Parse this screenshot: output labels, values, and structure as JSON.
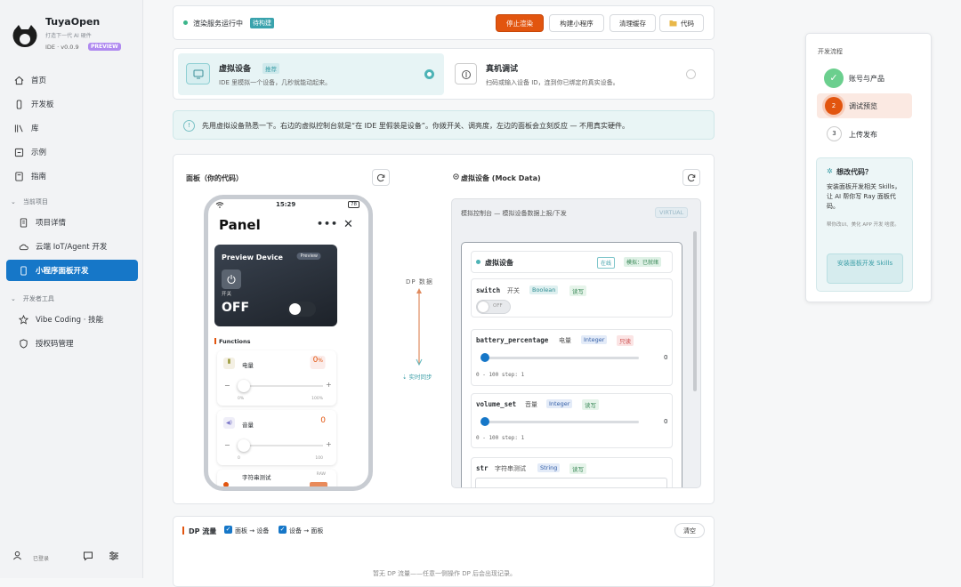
{
  "brand": {
    "name": "TuyaOpen",
    "tagline": "打造下一代 AI 硬件",
    "version": "IDE · v0.0.9",
    "badge": "PREVIEW"
  },
  "nav": {
    "items": [
      {
        "label": "首页",
        "icon": "home-icon"
      },
      {
        "label": "开发板",
        "icon": "board-icon"
      },
      {
        "label": "库",
        "icon": "library-icon"
      },
      {
        "label": "示例",
        "icon": "example-icon"
      },
      {
        "label": "指南",
        "icon": "guide-icon"
      }
    ],
    "section_project": "当前项目",
    "project_items": [
      {
        "label": "项目详情"
      },
      {
        "label": "云端 IoT/Agent 开发"
      },
      {
        "label": "小程序面板开发"
      }
    ],
    "section_tools": "开发者工具",
    "tool_items": [
      {
        "label": "Vibe Coding · 技能"
      },
      {
        "label": "授权码管理"
      }
    ],
    "user": {
      "name": "   ",
      "status": "已登录"
    }
  },
  "topbar": {
    "status": "渲染服务运行中",
    "status_badge": "待构建",
    "buttons": {
      "stop": "停止渲染",
      "build": "构建小程序",
      "clear": "清理缓存",
      "code": "代码"
    }
  },
  "modes": {
    "virtual": {
      "title": "虚拟设备",
      "tag": "推荐",
      "desc": "IDE 里模拟一个设备，几秒就能动起来。"
    },
    "real": {
      "title": "真机调试",
      "desc": "扫码或输入设备 ID，连到你已绑定的真实设备。"
    }
  },
  "hint": "先用虚拟设备熟悉一下。右边的虚拟控制台就是“在 IDE 里假装是设备”。你拨开关、调亮度，左边的面板会立刻反应 — 不用真实硬件。",
  "panel": {
    "title": "面板（你的代码）",
    "time": "15:29",
    "battery": "78",
    "header": "Panel",
    "device_name": "Preview Device",
    "device_badge": "Preview",
    "switch_label": "开关",
    "switch_state": "OFF",
    "functions_title": "Functions",
    "battery_fn": {
      "label": "电量",
      "value": "0",
      "unit": "%",
      "min": "0%",
      "max": "100%",
      "level": 0
    },
    "volume_fn": {
      "label": "音量",
      "value": "0",
      "min": "0",
      "max": "100",
      "level": 0
    },
    "string_fn": {
      "label": "字符串测试",
      "badge": "RAW"
    }
  },
  "middle": {
    "dp_label": "DP 数据",
    "sync_label": "实时同步"
  },
  "virtual": {
    "title": "虚拟设备 (Mock Data)",
    "console_title": "模拟控制台 — 模拟设备数据上报/下发",
    "console_badge": "VIRTUAL",
    "device_label": "虚拟设备",
    "online_tag": "在线",
    "ready_tag": "模拟：已就绪",
    "dps": [
      {
        "code": "switch",
        "name": "开关",
        "type": "Boolean",
        "mode": "读写",
        "toggle": "OFF"
      },
      {
        "code": "battery_percentage",
        "name": "电量",
        "type": "Integer",
        "mode": "只读",
        "value": "0",
        "range": "0 - 100 step: 1",
        "level": 0
      },
      {
        "code": "volume_set",
        "name": "音量",
        "type": "Integer",
        "mode": "读写",
        "value": "0",
        "range": "0 - 100 step: 1",
        "level": 0
      },
      {
        "code": "str",
        "name": "字符串测试",
        "type": "String",
        "mode": "读写"
      }
    ]
  },
  "flow": {
    "title": "DP 流量",
    "check1": "面板 → 设备",
    "check2": "设备 → 面板",
    "clear": "清空",
    "empty": "暂无 DP 流量——任意一侧操作 DP 后会出现记录。"
  },
  "steps": {
    "title": "开发流程",
    "items": [
      {
        "num": "✓",
        "label": "账号与产品"
      },
      {
        "num": "2",
        "label": "调试预览"
      },
      {
        "num": "3",
        "label": "上传发布"
      }
    ],
    "tip_title": "想改代码？",
    "tip_body": "安装面板开发相关 Skills，让 AI 帮你写 Ray 面板代码。",
    "tip_sub": "帮你改UI、美化 APP 开发 啥度。",
    "tip_button": "安装面板开发 Skills"
  },
  "colors": {
    "accent": "#1677c8",
    "primary": "#e2550f",
    "teal": "#4db3b6"
  }
}
